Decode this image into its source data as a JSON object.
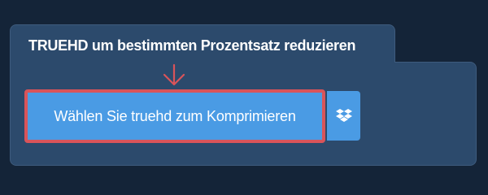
{
  "title": "TRUEHD um bestimmten Prozentsatz reduzieren",
  "upload_button": {
    "label": "Wählen Sie truehd zum Komprimieren"
  },
  "dropbox_button": {
    "icon": "dropbox-icon"
  },
  "colors": {
    "background": "#142438",
    "panel": "#2c4a6c",
    "button": "#4a9be4",
    "highlight": "#d9545a",
    "text": "#ffffff"
  }
}
